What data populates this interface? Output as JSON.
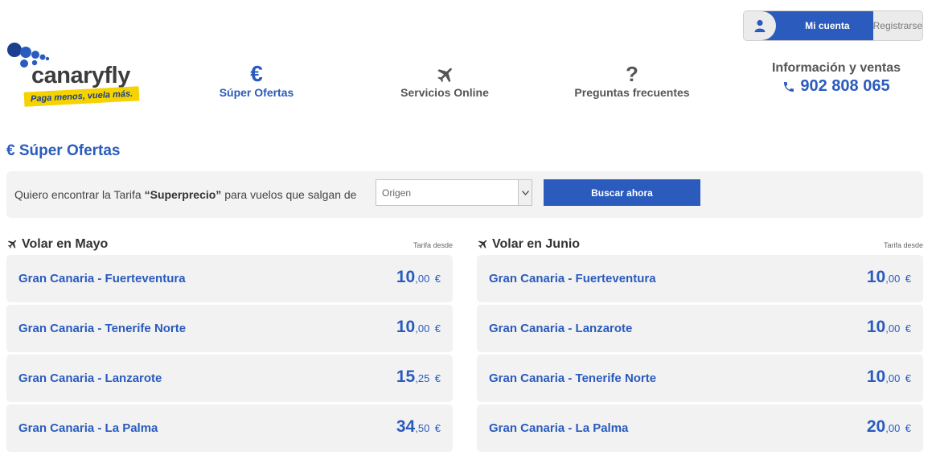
{
  "account": {
    "mine_label": "Mi cuenta",
    "register_label": "Registrarse"
  },
  "logo": {
    "name": "canaryfly",
    "tagline": "Paga menos, vuela más."
  },
  "nav": [
    {
      "label": "Súper Ofertas",
      "icon": "euro-icon"
    },
    {
      "label": "Servicios Online",
      "icon": "plane-icon"
    },
    {
      "label": "Preguntas frecuentes",
      "icon": "question-icon"
    }
  ],
  "info": {
    "title": "Información y ventas",
    "phone": "902 808 065"
  },
  "section": {
    "title": "€ Súper Ofertas"
  },
  "search": {
    "text_before": "Quiero encontrar la Tarifa ",
    "text_bold": "“Superprecio”",
    "text_after": " para vuelos que salgan de",
    "select_value": "Origen",
    "button_label": "Buscar ahora"
  },
  "columns": [
    {
      "title": "Volar en Mayo",
      "subtitle": "Tarifa desde",
      "rows": [
        {
          "route": "Gran Canaria - Fuerteventura",
          "int": "10",
          "dec": ",00",
          "cur": "€"
        },
        {
          "route": "Gran Canaria - Tenerife Norte",
          "int": "10",
          "dec": ",00",
          "cur": "€"
        },
        {
          "route": "Gran Canaria - Lanzarote",
          "int": "15",
          "dec": ",25",
          "cur": "€"
        },
        {
          "route": "Gran Canaria - La Palma",
          "int": "34",
          "dec": ",50",
          "cur": "€"
        }
      ]
    },
    {
      "title": "Volar en Junio",
      "subtitle": "Tarifa desde",
      "rows": [
        {
          "route": "Gran Canaria - Fuerteventura",
          "int": "10",
          "dec": ",00",
          "cur": "€"
        },
        {
          "route": "Gran Canaria - Lanzarote",
          "int": "10",
          "dec": ",00",
          "cur": "€"
        },
        {
          "route": "Gran Canaria - Tenerife Norte",
          "int": "10",
          "dec": ",00",
          "cur": "€"
        },
        {
          "route": "Gran Canaria - La Palma",
          "int": "20",
          "dec": ",00",
          "cur": "€"
        }
      ]
    }
  ],
  "colors": {
    "accent": "#2a5bbd",
    "logo_yellow": "#f5d200",
    "row_bg": "#f2f2f2"
  }
}
